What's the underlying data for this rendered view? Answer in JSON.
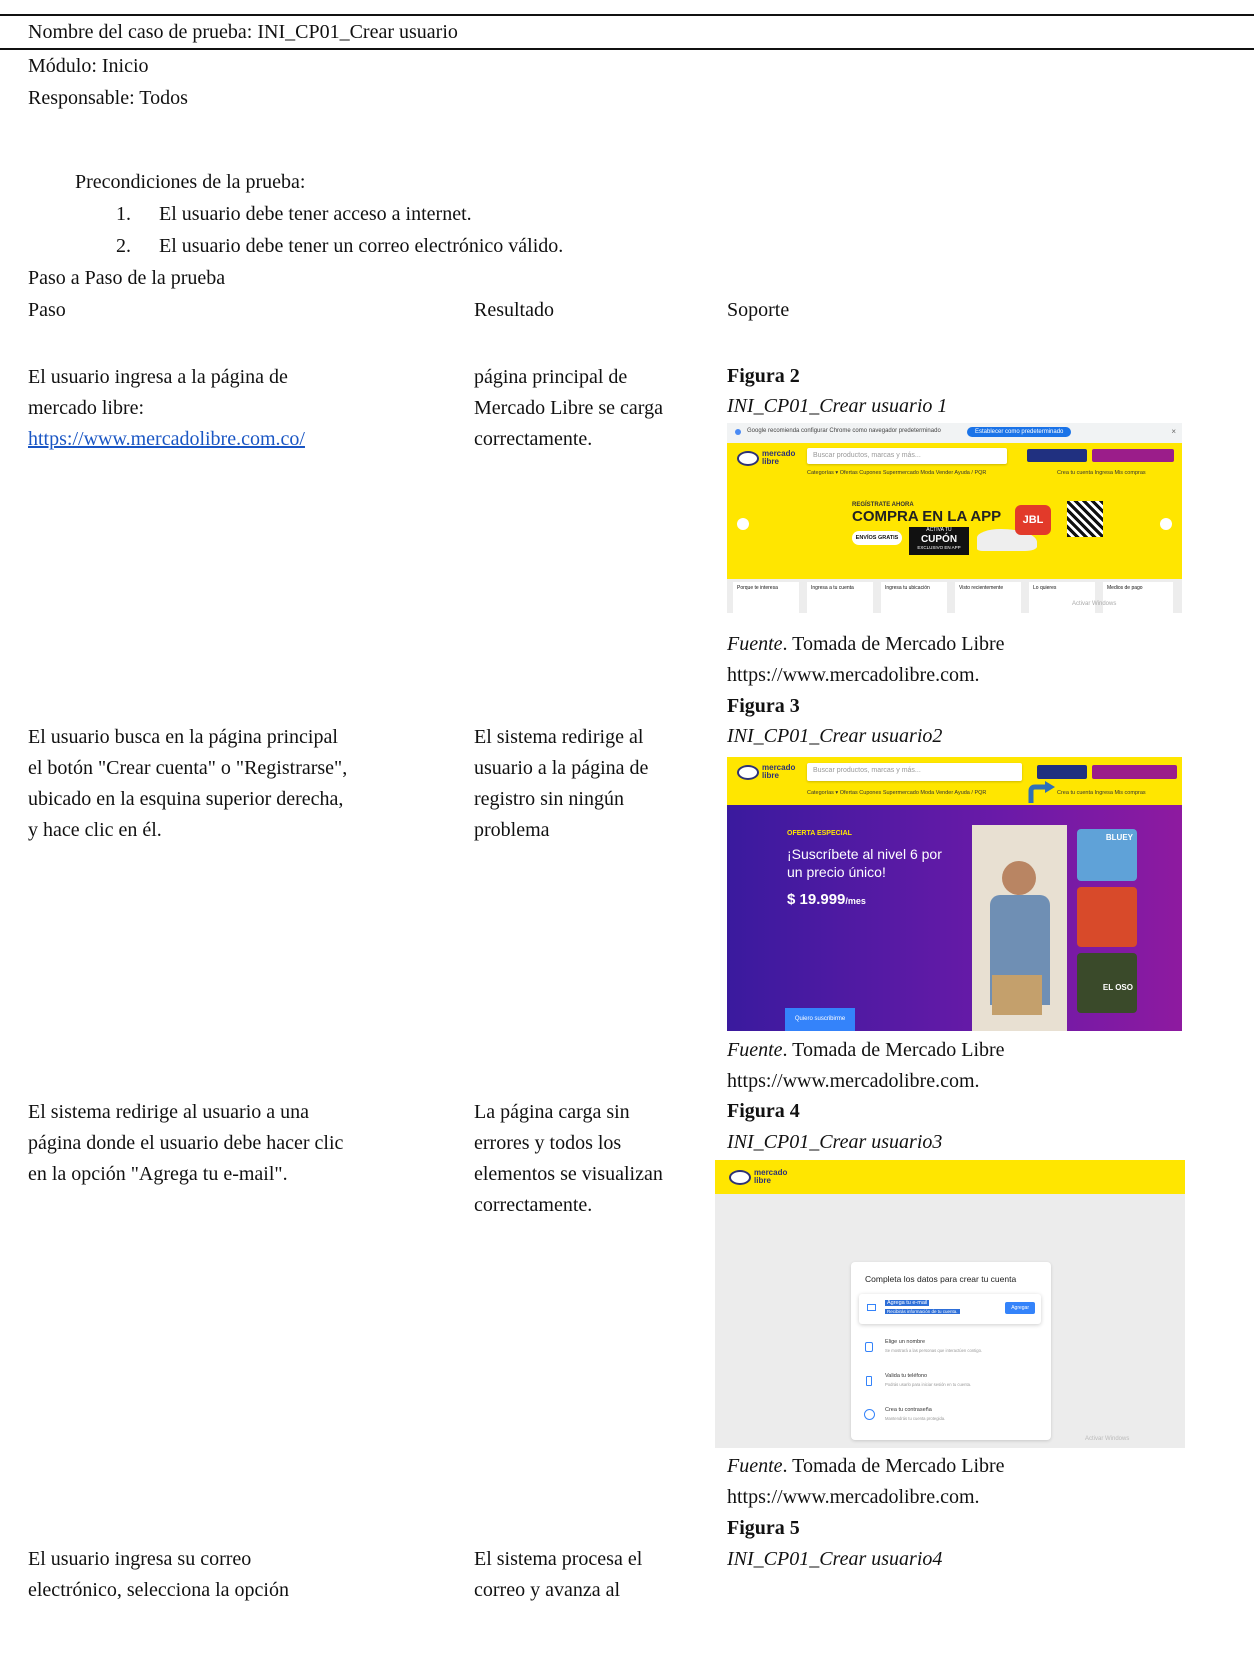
{
  "header": {
    "test_name": "Nombre del caso de prueba: INI_CP01_Crear usuario",
    "module": "Módulo: Inicio",
    "owner": "Responsable: Todos"
  },
  "preconditions": {
    "title": "Precondiciones de la prueba:",
    "items": [
      {
        "num": "1.",
        "text": "El usuario debe tener acceso a internet."
      },
      {
        "num": "2.",
        "text": "El usuario debe tener un correo electrónico válido."
      }
    ]
  },
  "steps_title": "Paso a Paso de la prueba",
  "columns": {
    "step": "Paso",
    "result": "Resultado",
    "support": "Soporte"
  },
  "rows": [
    {
      "step": [
        "El usuario ingresa a la página de",
        "mercado libre:"
      ],
      "link": "https://www.mercadolibre.com.co/",
      "result": [
        "página principal de",
        "Mercado Libre se carga",
        "correctamente."
      ],
      "figure": "Figura 2",
      "caption": "INI_CP01_Crear usuario 1",
      "source_label": "Fuente",
      "source_text": ". Tomada de Mercado Libre",
      "source_url": "https://www.mercadolibre.com."
    },
    {
      "step": [
        "El usuario busca en la página principal",
        "el botón \"Crear cuenta\" o \"Registrarse\",",
        "ubicado en la esquina superior derecha,",
        "y hace clic en él."
      ],
      "result": [
        "El sistema redirige al",
        "usuario a la página de",
        "registro sin ningún",
        "problema"
      ],
      "figure": "Figura 3",
      "caption": "INI_CP01_Crear usuario2",
      "source_label": "Fuente",
      "source_text": ". Tomada de Mercado Libre",
      "source_url": "https://www.mercadolibre.com."
    },
    {
      "step": [
        "El sistema redirige al usuario a una",
        "página donde el usuario debe hacer clic",
        "en la opción \"Agrega tu e-mail\"."
      ],
      "result": [
        "La página carga sin",
        "errores y todos los",
        "elementos se visualizan",
        "correctamente."
      ],
      "figure": "Figura 4",
      "caption": "INI_CP01_Crear usuario3",
      "source_label": "Fuente",
      "source_text": ". Tomada de Mercado Libre",
      "source_url": "https://www.mercadolibre.com."
    },
    {
      "step": [
        "El usuario ingresa su correo",
        "electrónico, selecciona la opción"
      ],
      "result": [
        "El sistema procesa el",
        "correo y avanza al"
      ],
      "figure": "Figura 5",
      "caption": "INI_CP01_Crear usuario4"
    }
  ],
  "shot1": {
    "chrome_notice": "Google recomienda configurar Chrome como navegador predeterminado",
    "chrome_button": "Establecer como predeterminado",
    "search_placeholder": "Buscar productos, marcas y más...",
    "nav": "Categorías ▾   Ofertas   Cupones   Supermercado   Moda   Vender   Ayuda / PQR",
    "account": "Crea tu cuenta   Ingresa   Mis compras",
    "promo_kicker": "REGÍSTRATE AHORA",
    "promo_title": "COMPRA EN LA APP",
    "envios": "ENVÍOS GRATIS",
    "coupon_top": "ACTIVA TU",
    "coupon": "CUPÓN",
    "coupon_sub": "EXCLUSIVO EN APP",
    "brand": "JBL",
    "cards": [
      "Porque te interesa",
      "Ingresa a tu cuenta",
      "Ingresa tu ubicación",
      "Visto recientemente",
      "Lo quieres",
      "Medios de pago"
    ],
    "watermark": "Activar Windows",
    "accent_yellow": "#ffe600"
  },
  "shot2": {
    "search_placeholder": "Buscar productos, marcas y más...",
    "nav": "Categorías ▾   Ofertas   Cupones   Supermercado   Moda   Vender   Ayuda / PQR",
    "account": "Crea tu cuenta   Ingresa   Mis compras",
    "offer_tag": "OFERTA ESPECIAL",
    "headline_1": "¡Suscríbete al nivel 6 por",
    "headline_2": "un precio único!",
    "price": "$ 19.999",
    "price_unit": "/mes",
    "cta": "Quiero suscribirme",
    "tile_1": "BLUEY",
    "tile_3": "EL OSO",
    "banner_bg": "#5b1a9e"
  },
  "shot3": {
    "card_title": "Completa los datos para crear tu cuenta",
    "items": [
      {
        "title": "Agrega tu e-mail",
        "sub": "Recibirás información de tu cuenta."
      },
      {
        "title": "Elige un nombre",
        "sub": "Se mostrará a las personas que interactúen contigo."
      },
      {
        "title": "Valida tu teléfono",
        "sub": "Podrás usarlo para iniciar sesión en tu cuenta."
      },
      {
        "title": "Crea tu contraseña",
        "sub": "Mantendrás tu cuenta protegida."
      }
    ],
    "add_button": "Agregar",
    "watermark": "Activar Windows"
  }
}
